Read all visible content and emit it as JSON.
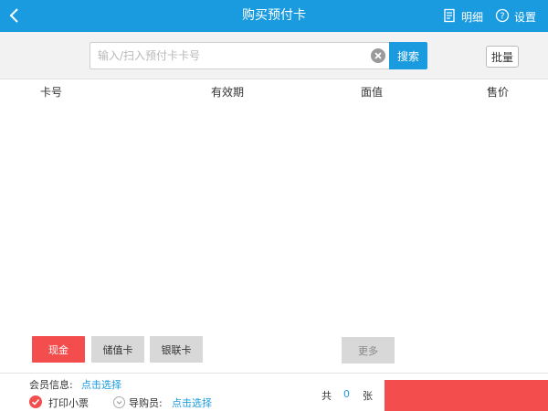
{
  "header": {
    "title": "购买预付卡",
    "detail_label": "明细",
    "settings_label": "设置",
    "icons": {
      "back": "chevron-left-icon",
      "detail": "receipt-icon",
      "settings": "help-circle-icon"
    }
  },
  "search": {
    "placeholder": "输入/扫入预付卡卡号",
    "value": "",
    "button_label": "搜索",
    "batch_label": "批量"
  },
  "table": {
    "columns": [
      "卡号",
      "有效期",
      "面值",
      "售价"
    ],
    "rows": []
  },
  "payment": {
    "methods": [
      "现金",
      "储值卡",
      "银联卡"
    ],
    "selected": "现金",
    "more_label": "更多"
  },
  "footer": {
    "member_label": "会员信息:",
    "member_select": "点击选择",
    "print_label": "打印小票",
    "print_checked": true,
    "guide_label": "导购员:",
    "guide_select": "点击选择",
    "total_prefix": "共",
    "total_count": "0",
    "total_suffix": "张"
  },
  "colors": {
    "accent": "#1a9be0",
    "danger": "#f44d4d",
    "disabled": "#d8d8d8"
  }
}
